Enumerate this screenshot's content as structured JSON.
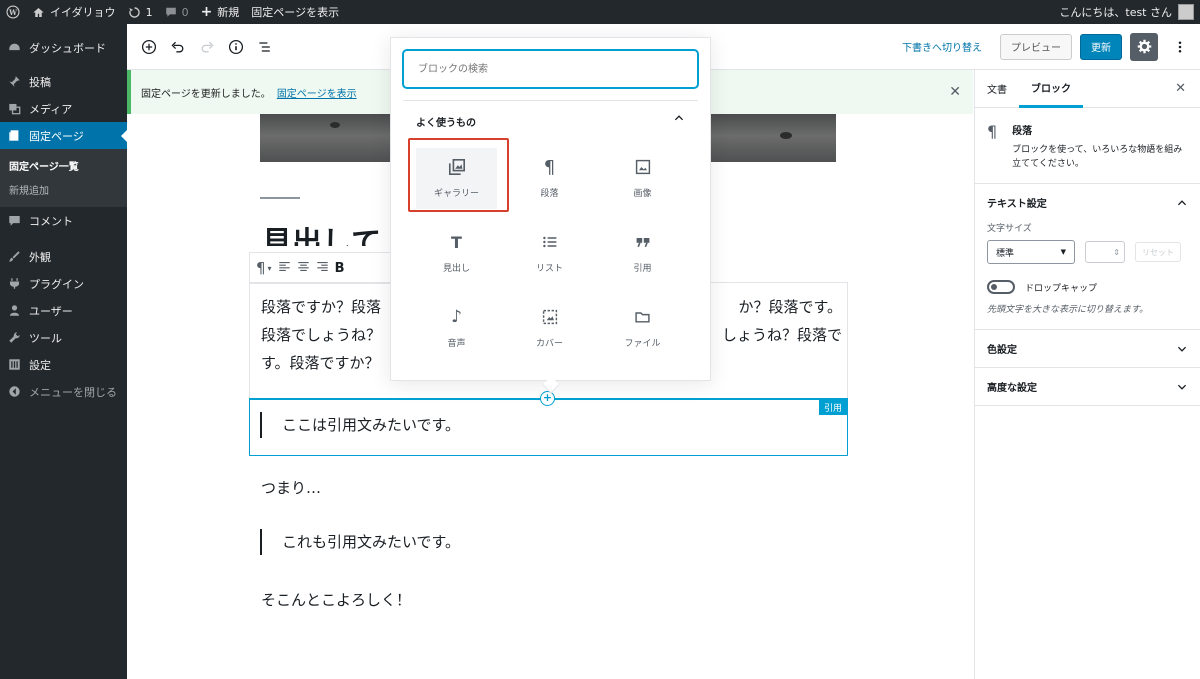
{
  "admin_bar": {
    "site_name": "イイダリョウ",
    "updates_count": "1",
    "comments_count": "0",
    "new_label": "新規",
    "view_page_label": "固定ページを表示",
    "greeting": "こんにちは、test さん"
  },
  "sidebar": {
    "items": [
      {
        "label": "ダッシュボード",
        "icon": "dashboard-icon"
      },
      {
        "label": "投稿",
        "icon": "pin-icon"
      },
      {
        "label": "メディア",
        "icon": "media-icon"
      },
      {
        "label": "固定ページ",
        "icon": "page-icon"
      },
      {
        "label": "コメント",
        "icon": "comment-icon"
      },
      {
        "label": "外観",
        "icon": "brush-icon"
      },
      {
        "label": "プラグイン",
        "icon": "plugin-icon"
      },
      {
        "label": "ユーザー",
        "icon": "user-icon"
      },
      {
        "label": "ツール",
        "icon": "wrench-icon"
      },
      {
        "label": "設定",
        "icon": "settings-icon"
      }
    ],
    "submenu": [
      "固定ページ一覧",
      "新規追加"
    ],
    "collapse_label": "メニューを閉じる"
  },
  "toolbar": {
    "draft_link": "下書きへ切り替え",
    "preview_label": "プレビュー",
    "update_label": "更新"
  },
  "notice": {
    "text": "固定ページを更新しました。",
    "link": "固定ページを表示"
  },
  "editor": {
    "heading": "見出して",
    "paragraph_lines": [
      "段落ですか？段落",
      "段落でしょうね？",
      "す。段落ですか？"
    ],
    "paragraph_lines_right": [
      "か？段落です。",
      "しょうね？段落で"
    ],
    "quote1": "ここは引用文みたいです。",
    "quote_tag": "引用",
    "para2": "つまり…",
    "quote2": "これも引用文みたいです。",
    "para3": "そこんとこよろしく！"
  },
  "inserter": {
    "search_placeholder": "ブロックの検索",
    "category": "よく使うもの",
    "blocks": [
      {
        "label": "ギャラリー",
        "icon": "gallery-icon"
      },
      {
        "label": "段落",
        "icon": "paragraph-icon"
      },
      {
        "label": "画像",
        "icon": "image-icon"
      },
      {
        "label": "見出し",
        "icon": "heading-icon"
      },
      {
        "label": "リスト",
        "icon": "list-icon"
      },
      {
        "label": "引用",
        "icon": "quote-icon"
      },
      {
        "label": "音声",
        "icon": "audio-icon"
      },
      {
        "label": "カバー",
        "icon": "cover-icon"
      },
      {
        "label": "ファイル",
        "icon": "file-icon"
      }
    ]
  },
  "settings": {
    "tab_document": "文書",
    "tab_block": "ブロック",
    "block_name": "段落",
    "block_desc": "ブロックを使って、いろいろな物語を組み立ててください。",
    "text_settings": "テキスト設定",
    "font_size_label": "文字サイズ",
    "font_size_value": "標準",
    "reset_label": "リセット",
    "drop_cap_label": "ドロップキャップ",
    "drop_cap_help": "先頭文字を大きな表示に切り替えます。",
    "color_settings": "色設定",
    "advanced": "高度な設定"
  },
  "colors": {
    "admin_dark": "#23282d",
    "accent_blue": "#0073aa",
    "focus_blue": "#00a0d2",
    "highlight_red": "#d6402c"
  }
}
